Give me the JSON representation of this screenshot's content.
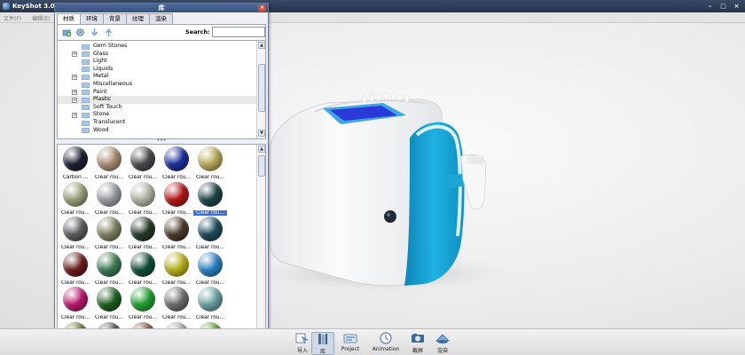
{
  "app": {
    "title": "KeyShot 3.0 B",
    "menu": [
      "文件(F)",
      "编辑(E)"
    ],
    "window_buttons": [
      "–",
      "□",
      "×"
    ]
  },
  "library": {
    "title": "库",
    "close_label": "×",
    "tabs": [
      {
        "label": "材质",
        "active": true
      },
      {
        "label": "环境",
        "active": false
      },
      {
        "label": "背景",
        "active": false
      },
      {
        "label": "纹理",
        "active": false
      },
      {
        "label": "渲染",
        "active": false
      }
    ],
    "search": {
      "label": "Search:",
      "value": "",
      "placeholder": ""
    },
    "tree": [
      {
        "label": "Gem Stones",
        "expandable": false,
        "selected": false
      },
      {
        "label": "Glass",
        "expandable": true,
        "selected": false
      },
      {
        "label": "Light",
        "expandable": false,
        "selected": false
      },
      {
        "label": "Liquids",
        "expandable": false,
        "selected": false
      },
      {
        "label": "Metal",
        "expandable": true,
        "selected": false
      },
      {
        "label": "Miscellaneous",
        "expandable": false,
        "selected": false
      },
      {
        "label": "Paint",
        "expandable": true,
        "selected": false
      },
      {
        "label": "Plastic",
        "expandable": true,
        "selected": true
      },
      {
        "label": "Soft Touch",
        "expandable": false,
        "selected": false
      },
      {
        "label": "Stone",
        "expandable": true,
        "selected": false
      },
      {
        "label": "Translucent",
        "expandable": false,
        "selected": false
      },
      {
        "label": "Wood",
        "expandable": false,
        "selected": false
      }
    ],
    "splitter_label": "•••",
    "materials": [
      {
        "label": "Carbon ...",
        "color": "#1c2030",
        "selected": false
      },
      {
        "label": "Clear rou...",
        "color": "#a98d74",
        "selected": false
      },
      {
        "label": "Clear rou...",
        "color": "#4a4a4c",
        "selected": false
      },
      {
        "label": "Clear rou...",
        "color": "#1c2f9c",
        "selected": false
      },
      {
        "label": "Clear rou...",
        "color": "#b9a858",
        "selected": false
      },
      {
        "label": "Clear rou...",
        "color": "#98a07a",
        "selected": false
      },
      {
        "label": "Clear rou...",
        "color": "#9a9ca0",
        "selected": false
      },
      {
        "label": "Clear rou...",
        "color": "#b2b4a4",
        "selected": false
      },
      {
        "label": "Clear rou...",
        "color": "#b41818",
        "selected": false
      },
      {
        "label": "Clear rou...",
        "color": "#1d4447",
        "selected": true
      },
      {
        "label": "Clear rou...",
        "color": "#5c5c5c",
        "selected": false
      },
      {
        "label": "Clear rou...",
        "color": "#7e8060",
        "selected": false
      },
      {
        "label": "Clear rou...",
        "color": "#243b26",
        "selected": false
      },
      {
        "label": "Clear rou...",
        "color": "#4a3a28",
        "selected": false
      },
      {
        "label": "Clear rou...",
        "color": "#1e4a5c",
        "selected": false
      },
      {
        "label": "Clear rou...",
        "color": "#6a1c1c",
        "selected": false
      },
      {
        "label": "Clear rou...",
        "color": "#3d7a52",
        "selected": false
      },
      {
        "label": "Clear rou...",
        "color": "#0f4e36",
        "selected": false
      },
      {
        "label": "Clear rou...",
        "color": "#b8b01a",
        "selected": false
      },
      {
        "label": "Clear rou...",
        "color": "#2a80c4",
        "selected": false
      },
      {
        "label": "Clear rou...",
        "color": "#b8186a",
        "selected": false
      },
      {
        "label": "Clear rou...",
        "color": "#1f5e1f",
        "selected": false
      },
      {
        "label": "Clear rou...",
        "color": "#22a030",
        "selected": false
      },
      {
        "label": "Clear rou...",
        "color": "#6c6c6c",
        "selected": false
      },
      {
        "label": "Clear rou...",
        "color": "#6aa0a0",
        "selected": false
      },
      {
        "label": "",
        "color": "#6a6a30",
        "selected": false
      },
      {
        "label": "",
        "color": "#4a4a4a",
        "selected": false
      },
      {
        "label": "",
        "color": "#7a4a28",
        "selected": false
      },
      {
        "label": "",
        "color": "#a0a0a0",
        "selected": false
      },
      {
        "label": "",
        "color": "#5aa030",
        "selected": false
      }
    ]
  },
  "bottom_toolbar": [
    {
      "label": "导入",
      "icon": "import-icon",
      "active": false
    },
    {
      "label": "库",
      "icon": "library-icon",
      "active": true
    },
    {
      "label": "Project",
      "icon": "project-icon",
      "active": false
    },
    {
      "label": "Animation",
      "icon": "animation-icon",
      "active": false
    },
    {
      "label": "截屏",
      "icon": "screenshot-icon",
      "active": false
    },
    {
      "label": "渲染",
      "icon": "render-icon",
      "active": false
    }
  ],
  "colors": {
    "product_body": "#f5f6f7",
    "product_accent": "#1aa6d6",
    "screen": "#2a3ad8"
  }
}
